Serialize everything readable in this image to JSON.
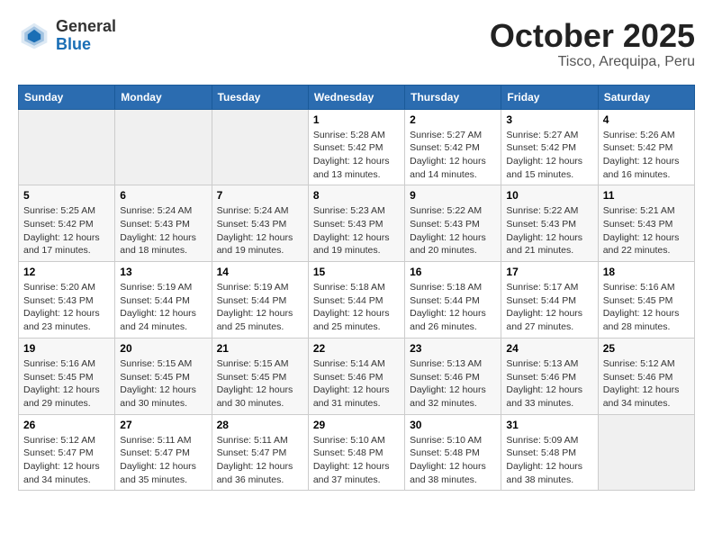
{
  "header": {
    "logo_general": "General",
    "logo_blue": "Blue",
    "title": "October 2025",
    "subtitle": "Tisco, Arequipa, Peru"
  },
  "weekdays": [
    "Sunday",
    "Monday",
    "Tuesday",
    "Wednesday",
    "Thursday",
    "Friday",
    "Saturday"
  ],
  "weeks": [
    [
      {
        "day": "",
        "info": ""
      },
      {
        "day": "",
        "info": ""
      },
      {
        "day": "",
        "info": ""
      },
      {
        "day": "1",
        "info": "Sunrise: 5:28 AM\nSunset: 5:42 PM\nDaylight: 12 hours\nand 13 minutes."
      },
      {
        "day": "2",
        "info": "Sunrise: 5:27 AM\nSunset: 5:42 PM\nDaylight: 12 hours\nand 14 minutes."
      },
      {
        "day": "3",
        "info": "Sunrise: 5:27 AM\nSunset: 5:42 PM\nDaylight: 12 hours\nand 15 minutes."
      },
      {
        "day": "4",
        "info": "Sunrise: 5:26 AM\nSunset: 5:42 PM\nDaylight: 12 hours\nand 16 minutes."
      }
    ],
    [
      {
        "day": "5",
        "info": "Sunrise: 5:25 AM\nSunset: 5:42 PM\nDaylight: 12 hours\nand 17 minutes."
      },
      {
        "day": "6",
        "info": "Sunrise: 5:24 AM\nSunset: 5:43 PM\nDaylight: 12 hours\nand 18 minutes."
      },
      {
        "day": "7",
        "info": "Sunrise: 5:24 AM\nSunset: 5:43 PM\nDaylight: 12 hours\nand 19 minutes."
      },
      {
        "day": "8",
        "info": "Sunrise: 5:23 AM\nSunset: 5:43 PM\nDaylight: 12 hours\nand 19 minutes."
      },
      {
        "day": "9",
        "info": "Sunrise: 5:22 AM\nSunset: 5:43 PM\nDaylight: 12 hours\nand 20 minutes."
      },
      {
        "day": "10",
        "info": "Sunrise: 5:22 AM\nSunset: 5:43 PM\nDaylight: 12 hours\nand 21 minutes."
      },
      {
        "day": "11",
        "info": "Sunrise: 5:21 AM\nSunset: 5:43 PM\nDaylight: 12 hours\nand 22 minutes."
      }
    ],
    [
      {
        "day": "12",
        "info": "Sunrise: 5:20 AM\nSunset: 5:43 PM\nDaylight: 12 hours\nand 23 minutes."
      },
      {
        "day": "13",
        "info": "Sunrise: 5:19 AM\nSunset: 5:44 PM\nDaylight: 12 hours\nand 24 minutes."
      },
      {
        "day": "14",
        "info": "Sunrise: 5:19 AM\nSunset: 5:44 PM\nDaylight: 12 hours\nand 25 minutes."
      },
      {
        "day": "15",
        "info": "Sunrise: 5:18 AM\nSunset: 5:44 PM\nDaylight: 12 hours\nand 25 minutes."
      },
      {
        "day": "16",
        "info": "Sunrise: 5:18 AM\nSunset: 5:44 PM\nDaylight: 12 hours\nand 26 minutes."
      },
      {
        "day": "17",
        "info": "Sunrise: 5:17 AM\nSunset: 5:44 PM\nDaylight: 12 hours\nand 27 minutes."
      },
      {
        "day": "18",
        "info": "Sunrise: 5:16 AM\nSunset: 5:45 PM\nDaylight: 12 hours\nand 28 minutes."
      }
    ],
    [
      {
        "day": "19",
        "info": "Sunrise: 5:16 AM\nSunset: 5:45 PM\nDaylight: 12 hours\nand 29 minutes."
      },
      {
        "day": "20",
        "info": "Sunrise: 5:15 AM\nSunset: 5:45 PM\nDaylight: 12 hours\nand 30 minutes."
      },
      {
        "day": "21",
        "info": "Sunrise: 5:15 AM\nSunset: 5:45 PM\nDaylight: 12 hours\nand 30 minutes."
      },
      {
        "day": "22",
        "info": "Sunrise: 5:14 AM\nSunset: 5:46 PM\nDaylight: 12 hours\nand 31 minutes."
      },
      {
        "day": "23",
        "info": "Sunrise: 5:13 AM\nSunset: 5:46 PM\nDaylight: 12 hours\nand 32 minutes."
      },
      {
        "day": "24",
        "info": "Sunrise: 5:13 AM\nSunset: 5:46 PM\nDaylight: 12 hours\nand 33 minutes."
      },
      {
        "day": "25",
        "info": "Sunrise: 5:12 AM\nSunset: 5:46 PM\nDaylight: 12 hours\nand 34 minutes."
      }
    ],
    [
      {
        "day": "26",
        "info": "Sunrise: 5:12 AM\nSunset: 5:47 PM\nDaylight: 12 hours\nand 34 minutes."
      },
      {
        "day": "27",
        "info": "Sunrise: 5:11 AM\nSunset: 5:47 PM\nDaylight: 12 hours\nand 35 minutes."
      },
      {
        "day": "28",
        "info": "Sunrise: 5:11 AM\nSunset: 5:47 PM\nDaylight: 12 hours\nand 36 minutes."
      },
      {
        "day": "29",
        "info": "Sunrise: 5:10 AM\nSunset: 5:48 PM\nDaylight: 12 hours\nand 37 minutes."
      },
      {
        "day": "30",
        "info": "Sunrise: 5:10 AM\nSunset: 5:48 PM\nDaylight: 12 hours\nand 38 minutes."
      },
      {
        "day": "31",
        "info": "Sunrise: 5:09 AM\nSunset: 5:48 PM\nDaylight: 12 hours\nand 38 minutes."
      },
      {
        "day": "",
        "info": ""
      }
    ]
  ]
}
